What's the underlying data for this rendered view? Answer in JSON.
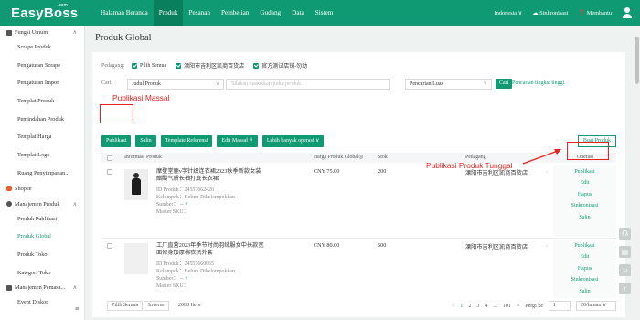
{
  "app": {
    "logo": "EasyBoss",
    "logo_suffix": ".com"
  },
  "nav": [
    "Halaman Beranda",
    "Produk",
    "Pesanan",
    "Pembelian",
    "Gudang",
    "Data",
    "Sistem"
  ],
  "top_right": {
    "region": "Indonesia ∨",
    "sync": "Sinkronisasi",
    "help": "Membantu"
  },
  "sidebar": {
    "group_general": "Fungsi Umum",
    "general_items": [
      "Scrape Produk",
      "Pengaturan Scrape",
      "Pengaturan Impor",
      "Templat Produk",
      "Pemindahan Produk",
      "Templat Harga",
      "Templat Logo",
      "Ruang Penyimpanan..."
    ],
    "shopee": "Shopee",
    "group_product": "Manajemen Produk",
    "product_items": [
      "Produk Publikasi",
      "Produk Global",
      "Produk Toko",
      "Kategori Toko"
    ],
    "group_promo": "Manajemen Pemasa...",
    "promo_items": [
      "Event Diskon"
    ]
  },
  "page": {
    "title": "Produk Global"
  },
  "filters": {
    "store_label": "Pedagang:",
    "select_all": "Pilih Semua",
    "store1": "溧阳市吉利区凯商百货店",
    "store2": "官方测试店铺-勿动",
    "search_label": "Cari:",
    "search_field": "Judul Produk",
    "search_placeholder": "Silakan masukkan judul produk",
    "search_mode": "Pencarian Luas",
    "search_button": "Cari",
    "advanced_search": "Pencarian tingkat tinggi"
  },
  "toolbar": {
    "publish": "Publikasi",
    "copy": "Salin",
    "template_ref": "Template Referensi",
    "edit_mass": "Edit Massal ∨",
    "more_ops": "Lebih banyak operasi ∨",
    "create_product": "Buat Produk"
  },
  "table": {
    "headers": [
      "Informasi Produk",
      "Harga Produk Global◎",
      "Stok",
      "Pedagang",
      "Operasi"
    ],
    "rows": [
      {
        "title": "摩登堂鹿v字针织连衣裙2023秋季新款女装醋酸气质长袖打底长衣裙",
        "id": "ID Produk：24557662426",
        "group": "Kelompok：Belum Dikelompokkan",
        "source_label": "Sumber：",
        "source_dash": "--",
        "source_plus": "+",
        "sku": "Master SKU：",
        "price": "CNY 75.00",
        "stock": "200",
        "merchant": "溧阳市吉利区凯商百货店",
        "ops": [
          "Publikasi",
          "Edit",
          "Hapus",
          "Sinkronisasi",
          "Salin"
        ]
      },
      {
        "title": "工厂直营2023年季节时尚羽绒服女中长款宽面修身加厚棉衣抗外套",
        "id": "ID Produk：24557660665",
        "group": "Kelompok：Belum Dikelompokkan",
        "source_label": "Sumber：",
        "source_dash": "--",
        "source_plus": "+",
        "sku": "Master SKU：",
        "price": "CNY 80.00",
        "stock": "500",
        "merchant": "溧阳市吉利区凯商百货店",
        "ops": [
          "Publikasi",
          "Edit",
          "Hapus",
          "Sinkronisasi",
          "Salin"
        ]
      }
    ]
  },
  "footer": {
    "select_all": "Pilih Semua",
    "inverse": "Inverse",
    "item_count": "2008 Item",
    "pages": [
      "<",
      "1",
      "2",
      "3",
      "4",
      "...",
      "101",
      ">"
    ],
    "goto_label": "Pergi ke",
    "goto_value": "1",
    "per_page": "20/laman ∨"
  },
  "annotations": {
    "mass_publish": "Publikasi Massal",
    "single_publish": "Publikasi Produk Tunggal"
  },
  "colors": {
    "brand": "#0f9a73",
    "annotation": "#e8231f"
  }
}
